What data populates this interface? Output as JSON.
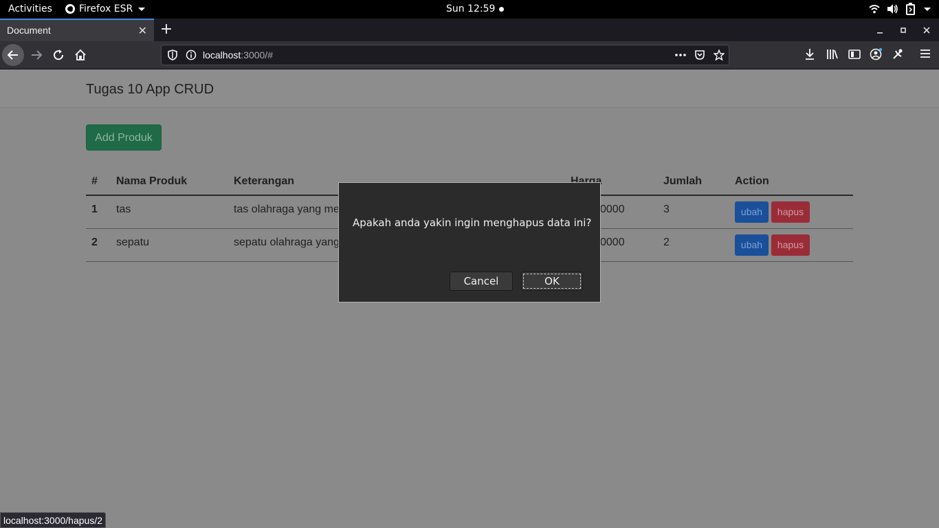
{
  "topbar": {
    "activities": "Activities",
    "app_name": "Firefox ESR",
    "clock": "Sun 12:59"
  },
  "browser": {
    "tab_title": "Document",
    "url_host": "localhost",
    "url_rest": ":3000/#",
    "status_url": "localhost:3000/hapus/2"
  },
  "page": {
    "brand": "Tugas 10 App CRUD",
    "add_button": "Add Produk",
    "table": {
      "headers": [
        "#",
        "Nama Produk",
        "Keterangan",
        "Harga",
        "Jumlah",
        "Action"
      ],
      "rows": [
        {
          "no": "1",
          "nama": "tas",
          "keterangan": "tas olahraga yang me",
          "harga": "0000",
          "jumlah": "3",
          "edit": "ubah",
          "delete": "hapus"
        },
        {
          "no": "2",
          "nama": "sepatu",
          "keterangan": "sepatu olahraga yang",
          "harga": "0000",
          "jumlah": "2",
          "edit": "ubah",
          "delete": "hapus"
        }
      ]
    }
  },
  "dialog": {
    "message": "Apakah anda yakin ingin menghapus data ini?",
    "cancel": "Cancel",
    "ok": "OK"
  }
}
